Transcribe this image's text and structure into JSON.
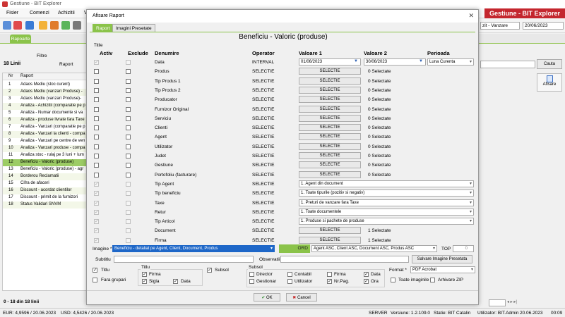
{
  "app": {
    "title": "Gestiune - BIT Explorer",
    "brand": "Gestiune - BIT Explorer"
  },
  "menu": [
    "Fisier",
    "Comenzi",
    "Achizitii",
    "V"
  ],
  "toolbar": {
    "right_field": "zit - Vanzare",
    "date": "20/06/2023"
  },
  "main_tab": "Rapoarte",
  "filters": {
    "label": "Filtre",
    "raport_label": "Raport",
    "count_label": "18 Linii",
    "search_button": "Cauta",
    "show_button": "Afisare"
  },
  "grid": {
    "columns": [
      "Nr",
      "Raport"
    ],
    "rows": [
      {
        "nr": "1",
        "name": "Adaos Mediu (stoc curent)"
      },
      {
        "nr": "2",
        "name": "Adaos Mediu (vanzari Produse) -"
      },
      {
        "nr": "3",
        "name": "Adaos Mediu (vanzari Produse)-"
      },
      {
        "nr": "4",
        "name": "Analiza - Achizitii (comparatie pe p"
      },
      {
        "nr": "5",
        "name": "Analiza - Numar documente si va"
      },
      {
        "nr": "6",
        "name": "Analiza - produse livrate fara Taxe"
      },
      {
        "nr": "7",
        "name": "Analiza - Vanzari (comparatie pe p"
      },
      {
        "nr": "8",
        "name": "Analiza - Vanzari la clienti - compa"
      },
      {
        "nr": "9",
        "name": "Analiza - Vanzari pe centre de ven"
      },
      {
        "nr": "10",
        "name": "Analiza - Vanzari produse - compa"
      },
      {
        "nr": "11",
        "name": "Analiza stoc - rulaj pe 3 luni + lum"
      },
      {
        "nr": "12",
        "name": "Beneficiu - Valoric (produse)"
      },
      {
        "nr": "13",
        "name": "Beneficiu - Valoric (produse) - agr"
      },
      {
        "nr": "14",
        "name": "Borderou Reclamatii"
      },
      {
        "nr": "15",
        "name": "Cifra de afaceri"
      },
      {
        "nr": "16",
        "name": "Discount - acordat clientilor"
      },
      {
        "nr": "17",
        "name": "Discount - primit de la furnizori"
      },
      {
        "nr": "18",
        "name": "Status Validari SNVM"
      }
    ],
    "footer": "0 - 18 din 18 linii"
  },
  "status": {
    "eur": "EUR: 4,9596 / 20.06.2023",
    "usd": "USD: 4,5426 / 20.06.2023",
    "server": "SERVER",
    "version": "Versiune: 1.2.109.0",
    "station": "Statie: BIT Catalin",
    "user": "Utilizator: BIT.Admin",
    "date": "20.06.2023",
    "time": "00:09"
  },
  "dialog": {
    "title": "Afisare Raport",
    "tabs": [
      "Raport",
      "Imagini Presetate"
    ],
    "report_title": "Beneficiu - Valoric (produse)",
    "section": "Titlie",
    "headers": {
      "activ": "Activ",
      "exclude": "Exclude",
      "denumire": "Denumire",
      "operator": "Operator",
      "val1": "Valoare 1",
      "val2": "Valoare 2",
      "perioada": "Perioada"
    },
    "rows": [
      {
        "name": "Data",
        "op": "INTERVAL",
        "v1": "01/06/2023",
        "v2": "30/06/2023",
        "per": "Luna Curenta",
        "kind": "date",
        "activ": true,
        "dis": true
      },
      {
        "name": "Produs",
        "op": "SELECTIE",
        "v1": "SELECTIE",
        "v2": "0 Selectate",
        "kind": "sel"
      },
      {
        "name": "Tip Produs 1",
        "op": "SELECTIE",
        "v1": "SELECTIE",
        "v2": "0 Selectate",
        "kind": "sel"
      },
      {
        "name": "Tip Produs 2",
        "op": "SELECTIE",
        "v1": "SELECTIE",
        "v2": "0 Selectate",
        "kind": "sel"
      },
      {
        "name": "Producator",
        "op": "SELECTIE",
        "v1": "SELECTIE",
        "v2": "0 Selectate",
        "kind": "sel"
      },
      {
        "name": "Furnizor Original",
        "op": "SELECTIE",
        "v1": "SELECTIE",
        "v2": "0 Selectate",
        "kind": "sel"
      },
      {
        "name": "Serviciu",
        "op": "SELECTIE",
        "v1": "SELECTIE",
        "v2": "0 Selectate",
        "kind": "sel"
      },
      {
        "name": "Clienti",
        "op": "SELECTIE",
        "v1": "SELECTIE",
        "v2": "0 Selectate",
        "kind": "sel"
      },
      {
        "name": "Agent",
        "op": "SELECTIE",
        "v1": "SELECTIE",
        "v2": "0 Selectate",
        "kind": "sel"
      },
      {
        "name": "Utilizator",
        "op": "SELECTIE",
        "v1": "SELECTIE",
        "v2": "0 Selectate",
        "kind": "sel"
      },
      {
        "name": "Judet",
        "op": "SELECTIE",
        "v1": "SELECTIE",
        "v2": "0 Selectate",
        "kind": "sel"
      },
      {
        "name": "Gestiune",
        "op": "SELECTIE",
        "v1": "SELECTIE",
        "v2": "0 Selectate",
        "kind": "sel"
      },
      {
        "name": "Portofoliu (facturare)",
        "op": "SELECTIE",
        "v1": "SELECTIE",
        "v2": "0 Selectate",
        "kind": "sel"
      },
      {
        "name": "Tip Agent",
        "op": "SELECTIE",
        "v1": "1. Agent din document",
        "kind": "dd",
        "activ": true,
        "dis": true
      },
      {
        "name": "Tip beneficiu",
        "op": "SELECTIE",
        "v1": "1. Toate tipurile (pozitiv si negativ)",
        "kind": "dd",
        "activ": true,
        "dis": true
      },
      {
        "name": "Taxe",
        "op": "SELECTIE",
        "v1": "1. Preturi de vanzare fara Taxe",
        "kind": "dd",
        "activ": true,
        "dis": true
      },
      {
        "name": "Retur",
        "op": "SELECTIE",
        "v1": "1. Toate documentele",
        "kind": "dd",
        "activ": true,
        "dis": true
      },
      {
        "name": "Tip Articol",
        "op": "SELECTIE",
        "v1": "1. Produse si pachete de produse",
        "kind": "dd",
        "activ": true,
        "dis": true
      },
      {
        "name": "Document",
        "op": "SELECTIE",
        "v1": "SELECTIE",
        "v2": "1 Selectate",
        "kind": "sel",
        "activ": true,
        "dis": true
      },
      {
        "name": "Firma",
        "op": "SELECTIE",
        "v1": "SELECTIE",
        "v2": "1 Selectate",
        "kind": "sel",
        "activ": true,
        "dis": true
      }
    ],
    "image_label": "Imagine *",
    "image_value": "Beneficiu - detaliat pe Agent, Client, Document, Produs",
    "ord_label": "ORD",
    "ord_value": "Agent ASC, Client ASC, Document ASC, Produs ASC",
    "top_label": "TOP",
    "top_value": "0",
    "subtitle_label": "Subtitlu",
    "obs_label": "Observatii",
    "save_image": "Salvare Imagine Presetata",
    "titlu_group": {
      "titlu": "Titlu",
      "fara_grupari": "Fara grupari"
    },
    "titlu2": {
      "header": "Titlu",
      "firma": "Firma",
      "sigla": "Sigla",
      "data": "Data"
    },
    "subsol": "Subsol",
    "subsol_group": {
      "header": "Subsol",
      "director": "Director",
      "gestionar": "Gestionar",
      "contabil": "Contabil",
      "utilizator": "Utilizator",
      "firma": "Firma",
      "nrpag": "Nr.Pag.",
      "data": "Data",
      "ora": "Ora"
    },
    "format_label": "Format *",
    "format_value": "PDF Acrobat",
    "toate_imaginile": "Toate imaginile",
    "arhivare": "Arhivare ZIP",
    "ok": "OK",
    "cancel": "Cancel"
  }
}
